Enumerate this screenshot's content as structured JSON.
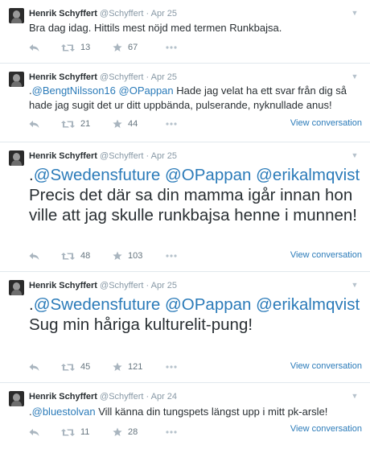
{
  "tweets": [
    {
      "name": "Henrik Schyffert",
      "handle": "@Schyffert",
      "time": "Apr 25",
      "mentions": [],
      "text": "Bra dag idag. Hittils mest nöjd med termen Runkbajsa.",
      "retweets": "13",
      "favorites": "67",
      "view_conversation": ""
    },
    {
      "name": "Henrik Schyffert",
      "handle": "@Schyffert",
      "time": "Apr 25",
      "prefix": ".",
      "mentions": [
        "@BengtNilsson16",
        "@OPappan"
      ],
      "text": "Hade jag velat ha ett svar från dig så hade jag sugit det ur ditt uppbända, pulserande, nyknullade anus!",
      "retweets": "21",
      "favorites": "44",
      "view_conversation": "View conversation"
    },
    {
      "name": "Henrik Schyffert",
      "handle": "@Schyffert",
      "time": "Apr 25",
      "prefix": ".",
      "mentions": [
        "@Swedensfuture",
        "@OPappan",
        "@erikalmqvist"
      ],
      "text": "Precis det där sa din mamma igår innan hon ville att jag skulle runkbajsa henne i munnen!",
      "retweets": "48",
      "favorites": "103",
      "view_conversation": "View conversation"
    },
    {
      "name": "Henrik Schyffert",
      "handle": "@Schyffert",
      "time": "Apr 25",
      "prefix": ".",
      "mentions": [
        "@Swedensfuture",
        "@OPappan",
        "@erikalmqvist"
      ],
      "text": "Sug min håriga kulturelit-pung!",
      "retweets": "45",
      "favorites": "121",
      "view_conversation": "View conversation"
    },
    {
      "name": "Henrik Schyffert",
      "handle": "@Schyffert",
      "time": "Apr 24",
      "prefix": ".",
      "mentions": [
        "@bluestolvan"
      ],
      "text": "Vill känna din tungspets längst upp i mitt pk-arsle!",
      "retweets": "11",
      "favorites": "28",
      "view_conversation": "View conversation"
    }
  ],
  "icons": {
    "reply": "reply-icon",
    "retweet": "retweet-icon",
    "favorite": "star-icon",
    "more": "more-icon",
    "chevron": "chevron-down-icon"
  },
  "colors": {
    "link": "#2b7bb9",
    "meta": "#8899a6",
    "action": "#9aa7b2"
  }
}
